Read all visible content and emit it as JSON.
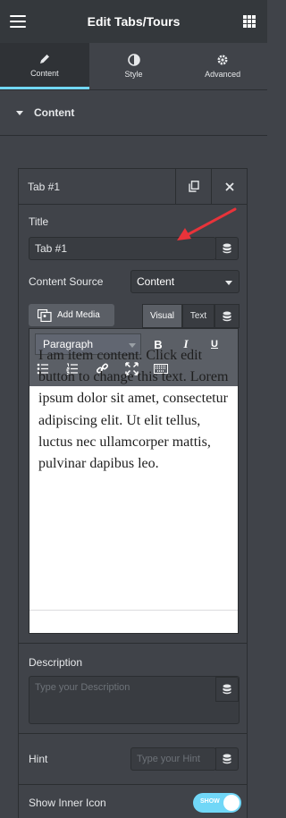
{
  "header": {
    "title": "Edit Tabs/Tours",
    "menu_icon": "hamburger-icon",
    "apps_icon": "grid-icon"
  },
  "tabs": [
    {
      "label": "Content",
      "icon": "pencil-icon",
      "active": true
    },
    {
      "label": "Style",
      "icon": "contrast-icon",
      "active": false
    },
    {
      "label": "Advanced",
      "icon": "gear-icon",
      "active": false
    }
  ],
  "section": {
    "title": "Content"
  },
  "item": {
    "heading": "Tab #1",
    "title_label": "Title",
    "title_value": "Tab #1",
    "content_source_label": "Content Source",
    "content_source_value": "Content",
    "add_media": "Add Media",
    "visual_tab": "Visual",
    "text_tab": "Text",
    "format_select": "Paragraph",
    "editor_text": "I am item content. Click edit button to change this text. Lorem ipsum dolor sit amet, consectetur adipiscing elit. Ut elit tellus, luctus nec ullamcorper mattis, pulvinar dapibus leo.",
    "description_label": "Description",
    "description_placeholder": "Type your Description",
    "hint_label": "Hint",
    "hint_placeholder": "Type your Hint",
    "show_inner_icon_label": "Show Inner Icon",
    "toggle_text": "SHOW",
    "toggle_on": true
  },
  "colors": {
    "accent": "#71d7f7",
    "panel": "#404349",
    "header": "#34383c"
  }
}
